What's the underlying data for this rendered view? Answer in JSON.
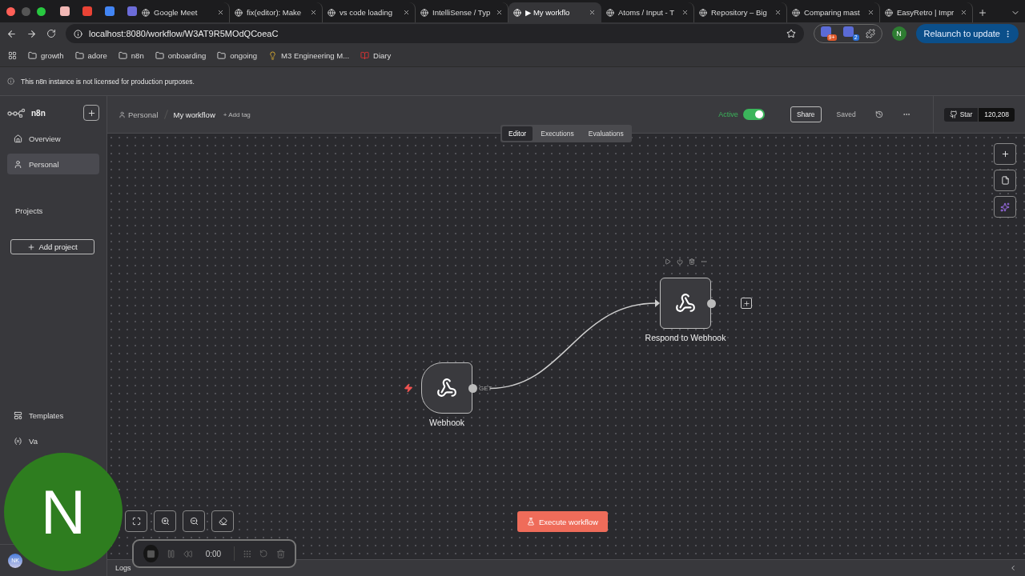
{
  "browser": {
    "tabs": [
      {
        "title": "Google Meet",
        "selected": false
      },
      {
        "title": "fix(editor): Make",
        "selected": false
      },
      {
        "title": "vs code loading",
        "selected": false
      },
      {
        "title": "IntelliSense / Typ",
        "selected": false
      },
      {
        "title": "▶ My workflo",
        "selected": true
      },
      {
        "title": "Atoms / Input - T",
        "selected": false
      },
      {
        "title": "Repository – Big",
        "selected": false
      },
      {
        "title": "Comparing mast",
        "selected": false
      },
      {
        "title": "EasyRetro | Impr",
        "selected": false
      }
    ],
    "url": "localhost:8080/workflow/W3AT9R5MOdQCoeaC",
    "extension_badges": [
      "9+",
      "2"
    ],
    "profile": "N",
    "relaunch": "Relaunch to update",
    "bookmarks": [
      {
        "label": "growth",
        "kind": "folder"
      },
      {
        "label": "adore",
        "kind": "folder"
      },
      {
        "label": "n8n",
        "kind": "folder"
      },
      {
        "label": "onboarding",
        "kind": "folder"
      },
      {
        "label": "ongoing",
        "kind": "folder"
      },
      {
        "label": "M3 Engineering M...",
        "kind": "idea"
      },
      {
        "label": "Diary",
        "kind": "book"
      }
    ]
  },
  "banner": "This n8n instance is not licensed for production purposes.",
  "sidebar": {
    "logo": "n8n",
    "items": [
      {
        "label": "Overview",
        "kind": "home",
        "selected": false
      },
      {
        "label": "Personal",
        "kind": "user",
        "selected": true
      }
    ],
    "projects_heading": "Projects",
    "add_project": "Add project",
    "bottom_items": [
      {
        "label": "Templates",
        "kind": "templates"
      },
      {
        "label": "Va",
        "kind": "variables"
      }
    ],
    "user_initials": "NK"
  },
  "header": {
    "project": "Personal",
    "workflow": "My workflow",
    "add_tag": "+ Add tag",
    "active": {
      "label": "Active",
      "on": true
    },
    "share": "Share",
    "status": "Saved",
    "github": {
      "label": "Star",
      "count": "120,208"
    }
  },
  "view_tabs": [
    {
      "label": "Editor",
      "selected": true
    },
    {
      "label": "Executions",
      "selected": false
    },
    {
      "label": "Evaluations",
      "selected": false
    }
  ],
  "canvas": {
    "nodes": [
      {
        "name": "Webhook",
        "kind": "trigger",
        "output_label": "GET"
      },
      {
        "name": "Respond to Webhook",
        "kind": "action"
      }
    ],
    "execute": "Execute workflow",
    "logs": "Logs"
  },
  "recorder": {
    "time": "0:00"
  },
  "webcam": {
    "initial": "N"
  }
}
